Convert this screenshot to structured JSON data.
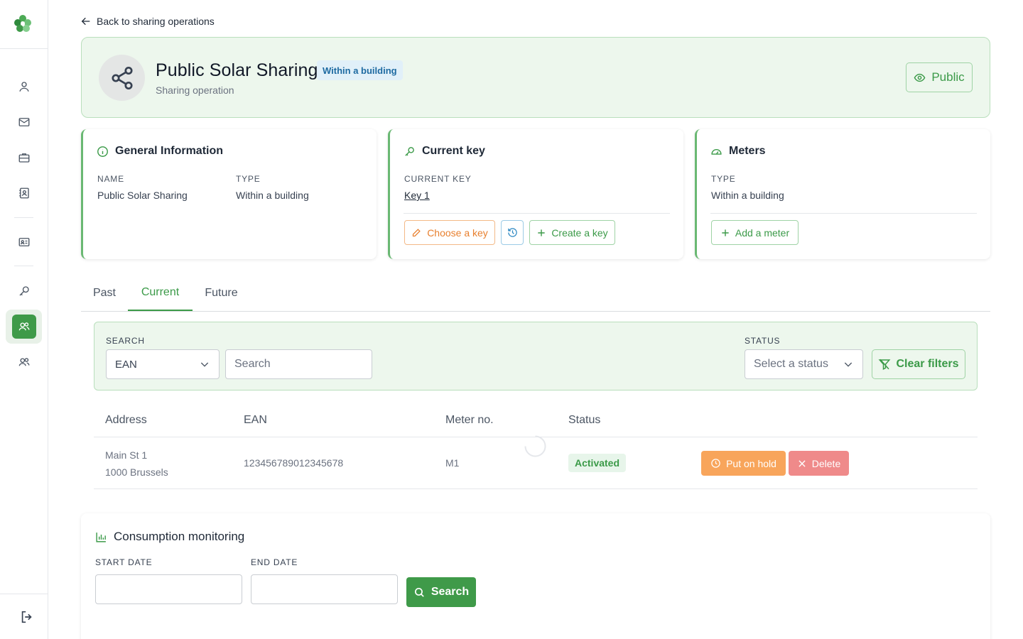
{
  "back_link": "Back to sharing operations",
  "header": {
    "title": "Public Solar Sharing",
    "badge": "Within a building",
    "subtitle": "Sharing operation",
    "visibility_button": "Public"
  },
  "general": {
    "title": "General Information",
    "name_label": "NAME",
    "name_value": "Public Solar Sharing",
    "type_label": "TYPE",
    "type_value": "Within a building"
  },
  "key": {
    "title": "Current key",
    "label": "CURRENT KEY",
    "value": "Key 1",
    "choose_button": "Choose a key",
    "create_button": "Create a key"
  },
  "meters": {
    "title": "Meters",
    "type_label": "TYPE",
    "type_value": "Within a building",
    "add_button": "Add a meter"
  },
  "tabs": [
    {
      "label": "Past"
    },
    {
      "label": "Current"
    },
    {
      "label": "Future"
    }
  ],
  "active_tab": "Current",
  "filters": {
    "search_label": "SEARCH",
    "search_field_value": "EAN",
    "search_placeholder": "Search",
    "status_label": "STATUS",
    "status_placeholder": "Select a status",
    "clear_button": "Clear filters"
  },
  "table": {
    "columns": [
      "Address",
      "EAN",
      "Meter no.",
      "Status"
    ],
    "rows": [
      {
        "address_line1": "Main St 1",
        "address_line2": "1000 Brussels",
        "ean": "123456789012345678",
        "meter_no": "M1",
        "status": "Activated",
        "hold_button": "Put on hold",
        "delete_button": "Delete"
      }
    ]
  },
  "consumption": {
    "title": "Consumption monitoring",
    "start_label": "START DATE",
    "end_label": "END DATE",
    "start_value": "",
    "end_value": "",
    "search_button": "Search"
  },
  "colors": {
    "primary_green": "#3f9a49",
    "light_green_bg": "#edf7ed",
    "badge_blue": "#1d6aa1",
    "choose_orange": "#e8802f",
    "hold_orange": "#f8a55b",
    "delete_red": "#ef8a8a"
  }
}
